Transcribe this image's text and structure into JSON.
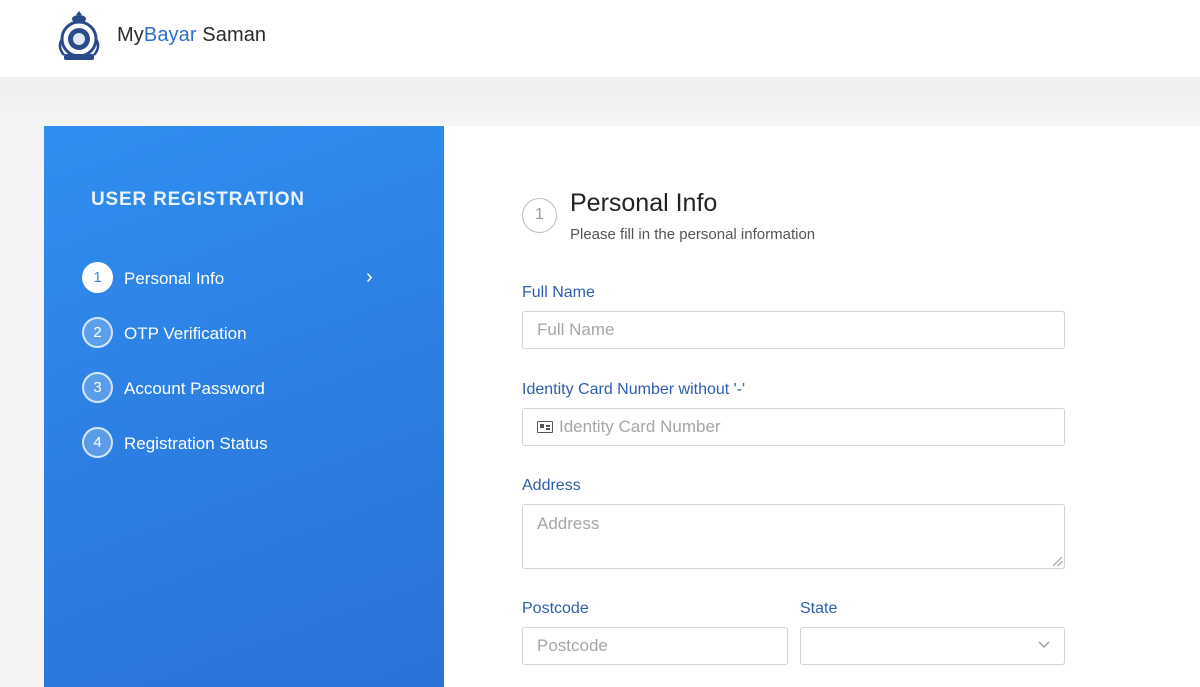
{
  "header": {
    "brand_prefix": "My",
    "brand_accent": "Bayar",
    "brand_suffix": " Saman",
    "logo_icon": "police-crest-logo"
  },
  "sidebar": {
    "title": "USER REGISTRATION",
    "steps": [
      {
        "number": "1",
        "label": "Personal Info",
        "active": true
      },
      {
        "number": "2",
        "label": "OTP Verification",
        "active": false
      },
      {
        "number": "3",
        "label": "Account Password",
        "active": false
      },
      {
        "number": "4",
        "label": "Registration Status",
        "active": false
      }
    ],
    "active_chevron": "›"
  },
  "form": {
    "step_number": "1",
    "title": "Personal Info",
    "subtitle": "Please fill in the personal information",
    "fields": {
      "full_name": {
        "label": "Full Name",
        "placeholder": "Full Name",
        "value": ""
      },
      "ic_number": {
        "label": "Identity Card Number without '-'",
        "placeholder": "Identity Card Number",
        "value": ""
      },
      "address": {
        "label": "Address",
        "placeholder": "Address",
        "value": ""
      },
      "postcode": {
        "label": "Postcode",
        "placeholder": "Postcode",
        "value": ""
      },
      "state": {
        "label": "State",
        "selected": ""
      }
    }
  },
  "colors": {
    "sidebar_gradient_start": "#2f8ff0",
    "sidebar_gradient_end": "#2b72d8",
    "label_blue": "#2e5eab",
    "brand_accent": "#2f6fc9"
  }
}
